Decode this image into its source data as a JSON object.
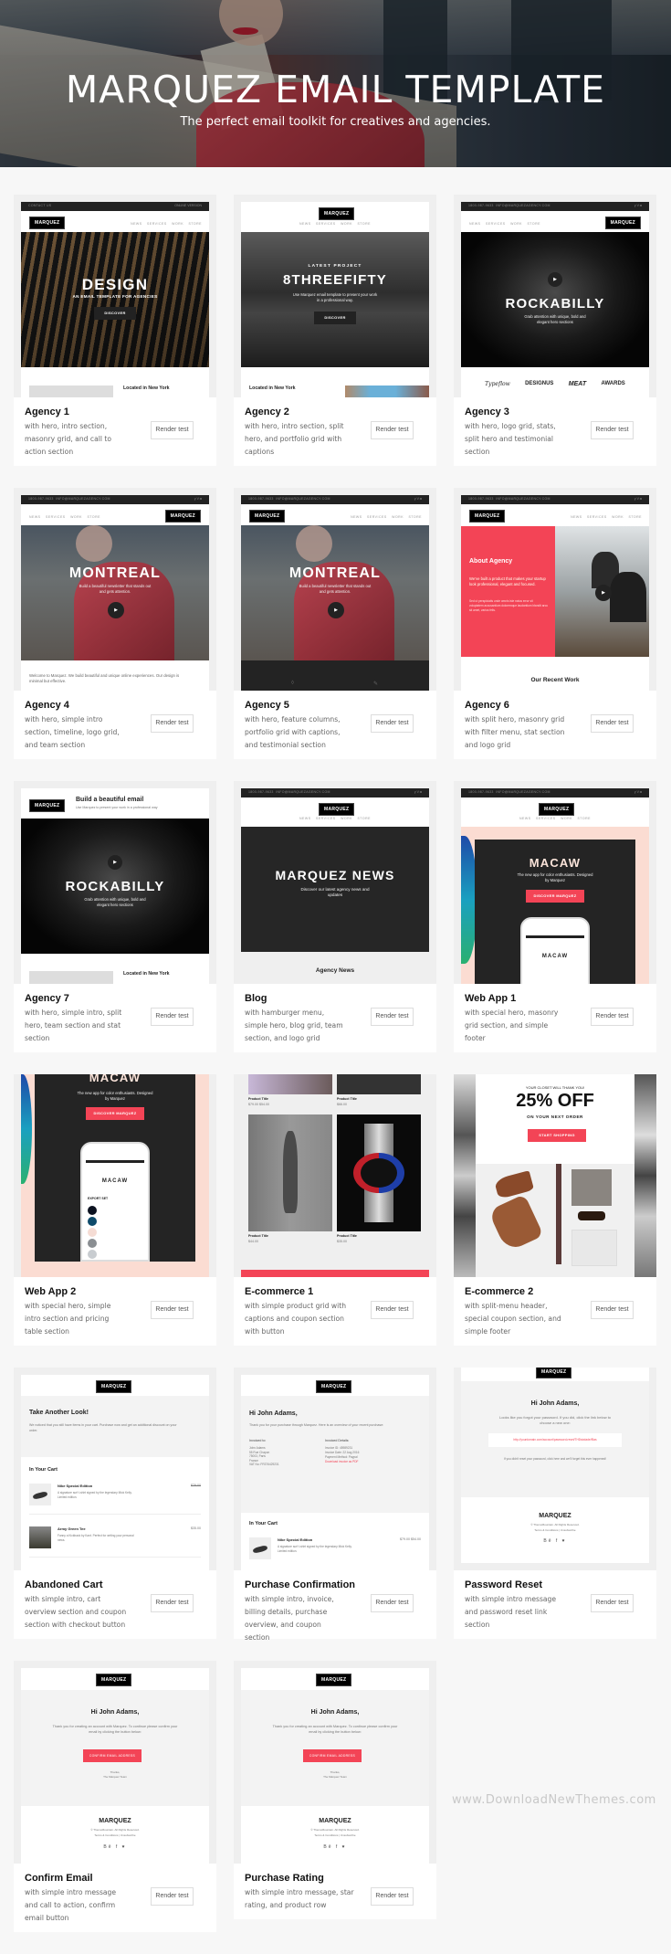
{
  "header": {
    "title": "MARQUEZ EMAIL TEMPLATE",
    "subtitle": "The perfect email toolkit for creatives and agencies."
  },
  "render_label": "Render test",
  "brand": "MARQUEZ",
  "nav": "NEWS SERVICES WORK STORE",
  "topbar": {
    "contact": "CONTACT US",
    "online": "ONLINE VERSION",
    "phone": "1800-987-9633",
    "email": "INFO@MARQUEZAGENCY.COM",
    "social": "y V ◘"
  },
  "accent_color": "#f34456",
  "cards": [
    {
      "title": "Agency 1",
      "desc": "with hero, intro section, masonry grid, and call to action section",
      "preview": {
        "hero_title": "DESIGN",
        "hero_sub": "AN EMAIL TEMPLATE FOR AGENCIES",
        "button": "DISCOVER",
        "section": "Located in New York"
      }
    },
    {
      "title": "Agency 2",
      "desc": "with hero, intro section, split hero, and portfolio grid with captions",
      "preview": {
        "kicker": "LATEST PROJECT",
        "hero_title": "8THREEFIFTY",
        "hero_sub": "Use Marquez email template to present your work in a professional way.",
        "button": "DISCOVER",
        "section": "Located in New York"
      }
    },
    {
      "title": "Agency 3",
      "desc": "with hero, logo grid, stats, split hero and testimonial section",
      "preview": {
        "hero_title": "ROCKABILLY",
        "hero_sub": "Grab attention with unique, bold and elegant hero sections",
        "logos": [
          "Typeflow",
          "DESIGNUS",
          "MEAT",
          "AWARDS"
        ]
      }
    },
    {
      "title": "Agency 4",
      "desc": "with hero, simple intro section, timeline, logo grid, and team section",
      "preview": {
        "hero_title": "MONTREAL",
        "hero_sub": "Build a beautiful newsletter that stands out and gets attention.",
        "intro": "Welcome to Marquez. We build beautiful and unique online experiences. Our design is minimal but effective."
      }
    },
    {
      "title": "Agency 5",
      "desc": "with hero, feature columns, portfolio grid with captions, and testimonial section",
      "preview": {
        "hero_title": "MONTREAL",
        "hero_sub": "Build a beautiful newsletter that stands out and gets attention."
      }
    },
    {
      "title": "Agency 6",
      "desc": "with split hero, masonry grid with filter menu, stat section and logo grid",
      "preview": {
        "hero_title": "About Agency",
        "hero_sub": "We've built a product that makes your startup look professional, elegant and focused.",
        "hero_body": "Sed ut perspiciatis unde omnis iste natus error sit voluptatem accusantium doloremque laudantium blandit arcu sit amet, varius felis.",
        "section": "Our Recent Work"
      }
    },
    {
      "title": "Agency 7",
      "desc": "with hero, simple intro, split hero, team section and stat section",
      "preview": {
        "header_title": "Build a beautiful email",
        "header_sub": "Use Marquez to present your work in a professional way",
        "hero_title": "ROCKABILLY",
        "hero_sub": "Grab attention with unique, bold and elegant hero sections",
        "section": "Located in New York"
      }
    },
    {
      "title": "Blog",
      "desc": "with hamburger menu, simple hero, blog grid, team section, and logo grid",
      "preview": {
        "hero_title": "MARQUEZ NEWS",
        "hero_sub": "Discover our latest agency news and updates",
        "section": "Agency News"
      }
    },
    {
      "title": "Web App 1",
      "desc": "with special hero, masonry grid section, and simple footer",
      "preview": {
        "hero_title": "MACAW",
        "hero_sub": "The new app for color enthusiasts. Designed by Marquez",
        "button": "DISCOVER MARQUEZ",
        "phone_title": "MACAW"
      }
    },
    {
      "title": "Web App 2",
      "desc": "with special hero, simple intro section and pricing table section",
      "preview": {
        "hero_title": "MACAW",
        "hero_sub": "The new app for color enthusiasts. Designed by Marquez",
        "button": "DISCOVER MARQUEZ",
        "phone_title": "MACAW",
        "phone_section": "EXPORT SET"
      }
    },
    {
      "title": "E-commerce 1",
      "desc": "with simple product grid with captions and coupon section with button",
      "preview": {
        "products": [
          {
            "name": "Product Title",
            "price": "$79.00 $54.00"
          },
          {
            "name": "Product Title",
            "price": "$66.00"
          },
          {
            "name": "Product Title",
            "price": "$44.00"
          },
          {
            "name": "Product Title",
            "price": "$35.00"
          }
        ]
      }
    },
    {
      "title": "E-commerce 2",
      "desc": "with split-menu header, special coupon section, and simple footer",
      "preview": {
        "kicker": "YOUR CLOSET WILL THANK YOU!",
        "hero_title": "25% OFF",
        "hero_sub": "ON YOUR NEXT ORDER",
        "button": "START SHOPPING"
      }
    },
    {
      "title": "Abandoned Cart",
      "desc": "with simple intro, cart overview section and coupon section with checkout button",
      "preview": {
        "heading": "Take Another Look!",
        "body": "We noticed that you still have items in your cart. Purchase now and get an additional discount on your order.",
        "section": "In Your Cart",
        "items": [
          {
            "name": "Nike Special Edition",
            "desc": "A signature surf t-shirt signed by the legendary Mick Kelly. Limited edition.",
            "old_price": "$79.00",
            "price": "$54.00"
          },
          {
            "name": "Army Green Tee",
            "desc": "Fanny a Kickback by Kant. Perfect for writing your personal news.",
            "old_price": "",
            "price": "$35.00"
          }
        ]
      }
    },
    {
      "title": "Purchase Confirmation",
      "desc": "with simple intro, invoice, billing details, purchase overview, and coupon section",
      "preview": {
        "heading": "Hi John Adams,",
        "body": "Thank you for your purchase through Marquez. Here is an overview of your recent purchase:",
        "invoiced_to_label": "Invoiced to:",
        "invoiced_to": "John Adams\n55 Rue Chapon\n75003, Paris\nFrance\nVAT No: FR376429231",
        "details_label": "Invoiced Details:",
        "details": "Invoice ID: 45989231\nInvoice Date: 22 Aug 2016\nPayment Method: Paypal",
        "download": "Download invoice as PDF",
        "section": "In Your Cart",
        "item": "Nike Special Edition",
        "item_desc": "A signature surf t-shirt signed by the legendary Mick Kelly. Limited edition.",
        "item_price": "$79.00 $54.00"
      }
    },
    {
      "title": "Password Reset",
      "desc": "with simple intro message and password reset link section",
      "preview": {
        "heading": "Hi John Adams,",
        "body": "Looks like you forgot your password. If you did, click the link below to choose a new one:",
        "link": "http://yourdomain.com/account/password-reset/THDsiwlade/f5as",
        "footnote": "If you didn't reset your password, click here and we'll forget this ever happened!",
        "footer_brand": "MARQUEZ",
        "footer_copy": "© ThemeMountain. All Rights Reserved.",
        "footer_links": "Terms & Conditions | Unsubscribe",
        "social": "Bē f ♥"
      }
    },
    {
      "title": "Confirm Email",
      "desc": "with simple intro message and call to action, confirm email button",
      "preview": {
        "heading": "Hi John Adams,",
        "body": "Thank you for creating an account with Marquez. To continue please confirm your email by clicking the button below:",
        "button": "CONFIRM EMAIL ADDRESS",
        "signoff": "Thanks,\nThe Marquez Team",
        "footer_brand": "MARQUEZ",
        "footer_copy": "© ThemeMountain. All Rights Reserved.",
        "footer_links": "Terms & Conditions | Unsubscribe",
        "social": "Bē f ♥"
      }
    },
    {
      "title": "Purchase Rating",
      "desc": "with simple intro message, star rating, and product row",
      "preview": {
        "heading": "Hi John Adams,",
        "body": "Thank you for creating an account with Marquez. To continue please confirm your email by clicking the button below:",
        "button": "CONFIRM EMAIL ADDRESS",
        "signoff": "Thanks,\nThe Marquez Team",
        "footer_brand": "MARQUEZ",
        "footer_copy": "© ThemeMountain. All Rights Reserved.",
        "footer_links": "Terms & Conditions | Unsubscribe",
        "social": "Bē f ♥"
      }
    }
  ],
  "watermark": "www.DownloadNewThemes.com"
}
